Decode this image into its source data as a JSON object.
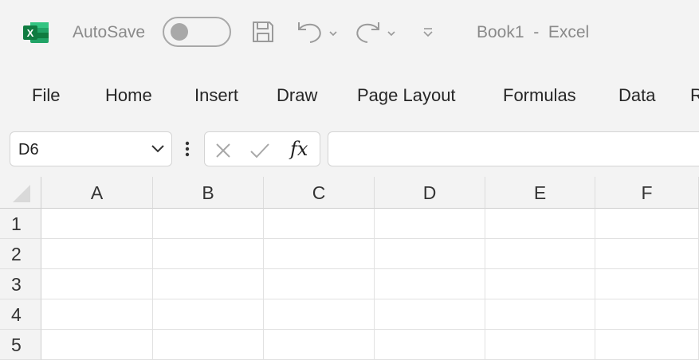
{
  "titlebar": {
    "app_icon": "excel-logo-icon",
    "autosave_label": "AutoSave",
    "autosave_on": false,
    "doc_title": "Book1  -  Excel",
    "quick_access_icons": [
      "save-icon",
      "undo-icon",
      "redo-icon",
      "customize-icon"
    ]
  },
  "tabs": [
    "File",
    "Home",
    "Insert",
    "Draw",
    "Page Layout",
    "Formulas",
    "Data",
    "R"
  ],
  "formula_bar": {
    "name_box_value": "D6",
    "fx_label": "fx",
    "formula_value": ""
  },
  "grid": {
    "columns": [
      "A",
      "B",
      "C",
      "D",
      "E",
      "F"
    ],
    "rows": [
      "1",
      "2",
      "3",
      "4",
      "5"
    ]
  },
  "colors": {
    "excel_green": "#107c41",
    "chrome_bg": "#f3f3f3",
    "muted_text": "#8a8a8a"
  }
}
